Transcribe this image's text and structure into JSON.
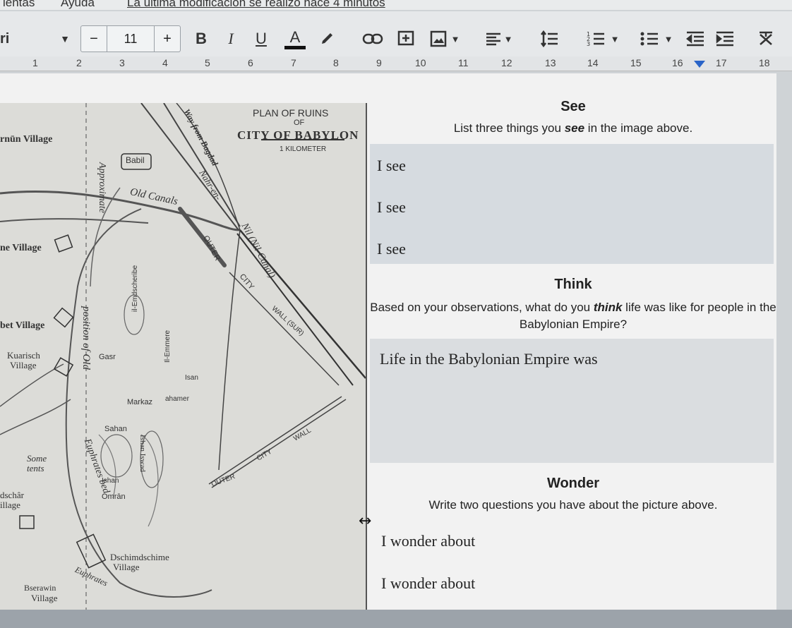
{
  "menubar": {
    "items": [
      "ientas",
      "Ayuda",
      "La última modificación se realizó hace 4 minutos"
    ]
  },
  "toolbar": {
    "font_name": "ri",
    "font_size": "11",
    "minus_label": "−",
    "plus_label": "+",
    "bold": "B",
    "italic": "I",
    "underline": "U",
    "text_color": "A"
  },
  "ruler": {
    "marks": [
      "1",
      "2",
      "3",
      "4",
      "5",
      "6",
      "7",
      "8",
      "9",
      "10",
      "11",
      "12",
      "13",
      "14",
      "15",
      "16",
      "17",
      "18"
    ]
  },
  "map": {
    "title_line1": "PLAN OF RUINS",
    "title_line2": "OF",
    "title_line3": "CITY OF BABYLON",
    "scale": "1 KILOMETER",
    "labels": {
      "babil": "Babil",
      "old_canals": "Old Canals",
      "way": "Way from Bagdad",
      "nahr": "Nahr-en-",
      "nil": "Nil (Nil-Canal)",
      "outer_city_1": "OUTER",
      "city_1": "CITY",
      "wall_1": "WALL (SUR)",
      "approx": "Approximate",
      "position": "position of Old",
      "euphrates_bed": "Euphrates bed",
      "euphrates": "Euphrates",
      "village_1": "rnūn Village",
      "village_2": "ne Village",
      "village_3": "bet Village",
      "kuaritsch": "Kuarisch",
      "kuaritsch_v": "Village",
      "some": "Some",
      "tents": "tents",
      "dschar": "dschâr",
      "illage": "illage",
      "dschimd": "Dschimdschime",
      "dschimd_v": "Village",
      "bserawin": "Bserawin",
      "bserawin_v": "Village",
      "gasr": "Gasr",
      "markaz": "Markaz",
      "amer": "ahamer",
      "sahan": "Sahan",
      "isan": "Isan",
      "omran": "Omrān",
      "ishan": "Ishan",
      "il_emdsch": "il-Emdscheribe",
      "il_emmere": "Il-Emmere",
      "outer_city_2": "OUTER",
      "city_2": "CITY",
      "wall_2": "WALL",
      "ishan_aswad": "Ishan Iswad"
    }
  },
  "worksheet": {
    "see": {
      "heading": "See",
      "instruction_pre": "List three things you ",
      "instruction_em": "see",
      "instruction_post": " in the image above.",
      "lines": [
        "I see",
        "I see",
        "I see"
      ]
    },
    "think": {
      "heading": "Think",
      "instruction_pre": "Based on your observations, what do you ",
      "instruction_em": "think",
      "instruction_post": " life was like for people in the Babylonian Empire?",
      "line": "Life in the Babylonian Empire was"
    },
    "wonder": {
      "heading": "Wonder",
      "instruction": "Write two questions you have about the picture above.",
      "lines": [
        "I wonder about",
        "I wonder about"
      ]
    }
  }
}
